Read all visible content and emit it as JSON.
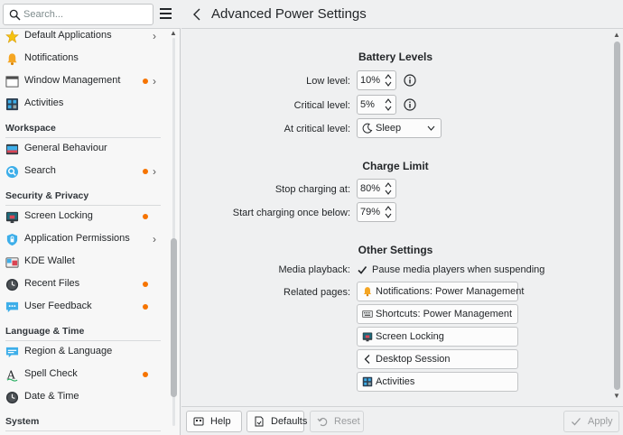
{
  "sidebar": {
    "search": {
      "placeholder": "Search..."
    },
    "items": [
      {
        "label": "Default Applications",
        "icon": "star-icon",
        "dot": false,
        "chevron": true
      },
      {
        "label": "Notifications",
        "icon": "bell-icon",
        "dot": false,
        "chevron": false
      },
      {
        "label": "Window Management",
        "icon": "window-icon",
        "dot": true,
        "chevron": true
      },
      {
        "label": "Activities",
        "icon": "activities-icon",
        "dot": false,
        "chevron": false
      }
    ],
    "sections": [
      {
        "title": "Workspace",
        "items": [
          {
            "label": "General Behaviour",
            "icon": "general-behaviour-icon",
            "dot": false,
            "chevron": false
          },
          {
            "label": "Search",
            "icon": "magnifier-icon",
            "dot": true,
            "chevron": true
          }
        ]
      },
      {
        "title": "Security & Privacy",
        "items": [
          {
            "label": "Screen Locking",
            "icon": "screen-locking-icon",
            "dot": true,
            "chevron": false
          },
          {
            "label": "Application Permissions",
            "icon": "shield-icon",
            "dot": false,
            "chevron": true
          },
          {
            "label": "KDE Wallet",
            "icon": "wallet-icon",
            "dot": false,
            "chevron": false
          },
          {
            "label": "Recent Files",
            "icon": "clock-icon",
            "dot": true,
            "chevron": false
          },
          {
            "label": "User Feedback",
            "icon": "feedback-icon",
            "dot": true,
            "chevron": false
          }
        ]
      },
      {
        "title": "Language & Time",
        "items": [
          {
            "label": "Region & Language",
            "icon": "speech-bubble-icon",
            "dot": false,
            "chevron": false
          },
          {
            "label": "Spell Check",
            "icon": "spell-check-icon",
            "dot": true,
            "chevron": false
          },
          {
            "label": "Date & Time",
            "icon": "clock-icon",
            "dot": false,
            "chevron": false
          }
        ]
      },
      {
        "title": "System",
        "items": []
      }
    ]
  },
  "header": {
    "title": "Advanced Power Settings"
  },
  "battery": {
    "title": "Battery Levels",
    "low_label": "Low level:",
    "low_value": "10%",
    "critical_label": "Critical level:",
    "critical_value": "5%",
    "action_label": "At critical level:",
    "action_value": "Sleep"
  },
  "charge": {
    "title": "Charge Limit",
    "stop_label": "Stop charging at:",
    "stop_value": "80%",
    "start_label": "Start charging once below:",
    "start_value": "79%"
  },
  "other": {
    "title": "Other Settings",
    "media_label": "Media playback:",
    "media_checkbox": "Pause media players when suspending",
    "media_checked": true,
    "related_label": "Related pages:",
    "related": [
      "Notifications: Power Management",
      "Shortcuts: Power Management",
      "Screen Locking",
      "Desktop Session",
      "Activities"
    ]
  },
  "footer": {
    "help": "Help",
    "defaults": "Defaults",
    "reset": "Reset",
    "apply": "Apply"
  },
  "colors": {
    "accent": "#3daee9",
    "dot": "#f67400",
    "window_bg": "#eff0f1"
  }
}
